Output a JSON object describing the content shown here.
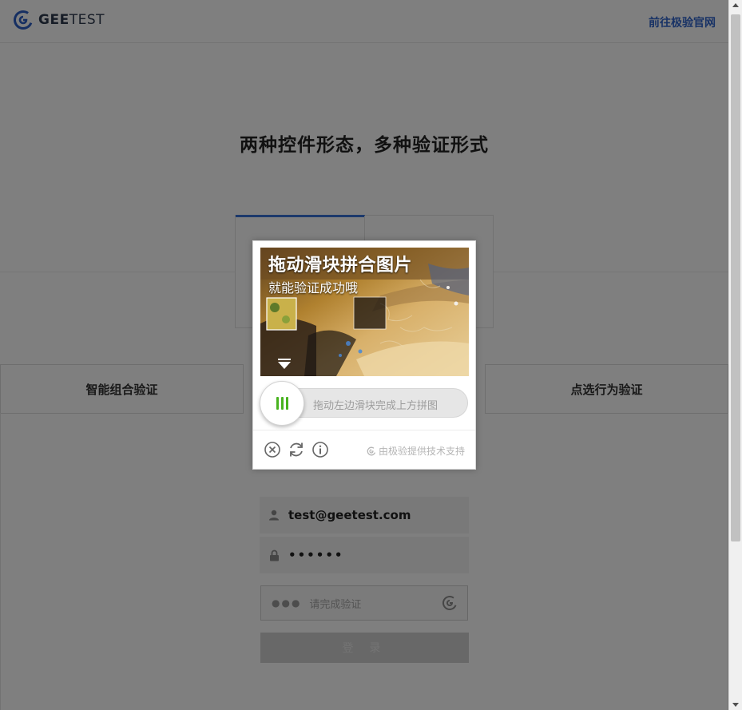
{
  "header": {
    "logo_text_bold": "GEE",
    "logo_text_light": "TEST",
    "link_label": "前往极验官网"
  },
  "page": {
    "headline": "两种控件形态，多种验证形式"
  },
  "mode_tabs": {
    "left_label": "智能组合验证",
    "right_label": "点选行为验证"
  },
  "form": {
    "email_value": "test@geetest.com",
    "password_value": "••••••",
    "captcha_dots": "●●●",
    "captcha_placeholder": "请完成验证",
    "login_label": "登 录"
  },
  "captcha_popup": {
    "title": "拖动滑块拼合图片",
    "subtitle": "就能验证成功哦",
    "slider_hint": "拖动左边滑块完成上方拼图",
    "powered_by": "由极验提供技术支持",
    "icons": [
      "close-icon",
      "refresh-icon",
      "info-icon"
    ]
  },
  "colors": {
    "accent": "#3973d6",
    "link": "#3366cc",
    "knob_green": "#48b31f"
  }
}
